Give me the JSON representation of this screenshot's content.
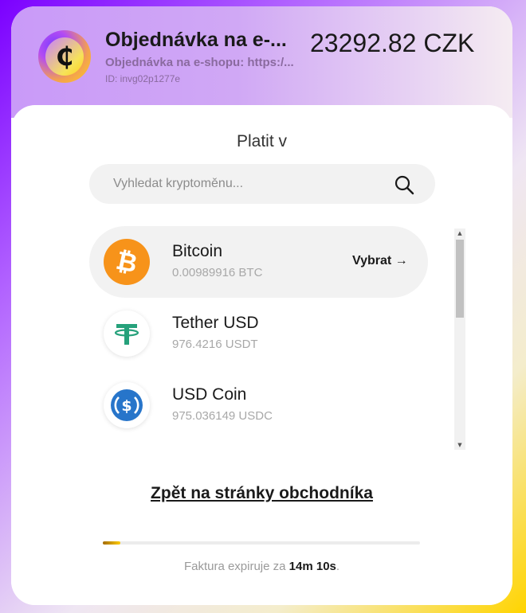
{
  "header": {
    "title": "Objednávka na e-...",
    "amount": "23292.82 CZK",
    "subtitle": "Objednávka na e-shopu: https:/...",
    "invoice_id": "ID: invg02p1277e",
    "logo_glyph": "₵"
  },
  "payment": {
    "heading": "Platit v",
    "search_placeholder": "Vyhledat kryptoměnu...",
    "coins": [
      {
        "name": "Bitcoin",
        "amount": "0.00989916 BTC",
        "select_label": "Vybrat →",
        "selected": true,
        "icon": "bitcoin-icon",
        "color": "#f7931a"
      },
      {
        "name": "Tether USD",
        "amount": "976.4216 USDT",
        "icon": "tether-icon",
        "color": "#26a17b"
      },
      {
        "name": "USD Coin",
        "amount": "975.036149 USDC",
        "icon": "usdc-icon",
        "color": "#2775ca"
      }
    ]
  },
  "footer": {
    "back_link": "Zpět na stránky obchodníka",
    "progress_fraction": 0.055,
    "expiry_text": "Faktura expiruje za ",
    "expiry_time": "14m 10s",
    "expiry_suffix": "."
  },
  "scrollbar": {
    "up_arrow": "▲",
    "down_arrow": "▼"
  }
}
